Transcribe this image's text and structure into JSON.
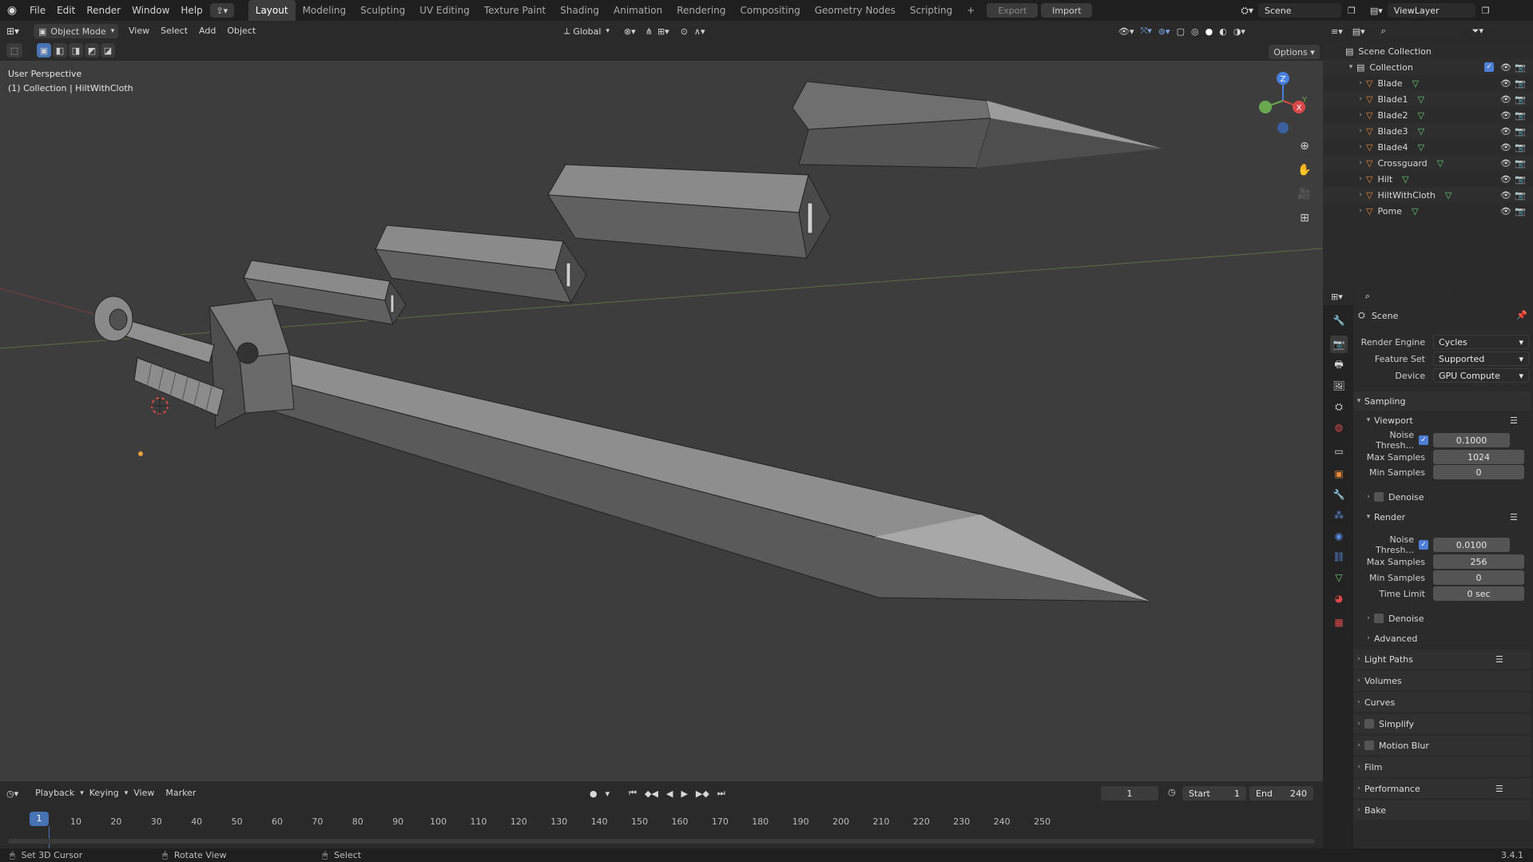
{
  "topbar": {
    "menus": [
      "File",
      "Edit",
      "Render",
      "Window",
      "Help"
    ],
    "workspaces": [
      "Layout",
      "Modeling",
      "Sculpting",
      "UV Editing",
      "Texture Paint",
      "Shading",
      "Animation",
      "Rendering",
      "Compositing",
      "Geometry Nodes",
      "Scripting"
    ],
    "add_tab": "+",
    "export_label": "Export",
    "import_label": "Import",
    "scene_name": "Scene",
    "view_layer": "ViewLayer"
  },
  "viewport_header": {
    "mode": "Object Mode",
    "menus": [
      "View",
      "Select",
      "Add",
      "Object"
    ],
    "transform_orientation": "Global",
    "options_label": "Options"
  },
  "viewport": {
    "perspective_label": "User Perspective",
    "collection_label": "(1) Collection | HiltWithCloth",
    "gizmo_axes": [
      "Z",
      "Y",
      "X"
    ]
  },
  "outliner": {
    "root": "Scene Collection",
    "collection": "Collection",
    "objects": [
      "Blade",
      "Blade1",
      "Blade2",
      "Blade3",
      "Blade4",
      "Crossguard",
      "Hilt",
      "HiltWithCloth",
      "Pome"
    ]
  },
  "properties": {
    "context_title": "Scene",
    "render_engine_label": "Render Engine",
    "render_engine": "Cycles",
    "feature_set_label": "Feature Set",
    "feature_set": "Supported",
    "device_label": "Device",
    "device": "GPU Compute",
    "sampling": "Sampling",
    "viewport_sub": "Viewport",
    "noise_thresh_label": "Noise Thresh...",
    "vp_noise": "0.1000",
    "max_samples_label": "Max Samples",
    "vp_max": "1024",
    "min_samples_label": "Min Samples",
    "vp_min": "0",
    "denoise": "Denoise",
    "render_sub": "Render",
    "r_noise": "0.0100",
    "r_max": "256",
    "r_min": "0",
    "time_limit_label": "Time Limit",
    "r_time": "0 sec",
    "advanced": "Advanced",
    "sections": [
      "Light Paths",
      "Volumes",
      "Curves",
      "Simplify",
      "Motion Blur",
      "Film",
      "Performance",
      "Bake"
    ]
  },
  "timeline": {
    "menus": [
      "Playback",
      "Keying",
      "View",
      "Marker"
    ],
    "current_frame": "1",
    "start_label": "Start",
    "start": "1",
    "end_label": "End",
    "end": "240",
    "ticks": [
      "1",
      "10",
      "20",
      "30",
      "40",
      "50",
      "60",
      "70",
      "80",
      "90",
      "100",
      "110",
      "120",
      "130",
      "140",
      "150",
      "160",
      "170",
      "180",
      "190",
      "200",
      "210",
      "220",
      "230",
      "240",
      "250"
    ]
  },
  "statusbar": {
    "hint1": "Set 3D Cursor",
    "hint2": "Rotate View",
    "hint3": "Select",
    "version": "3.4.1"
  },
  "colors": {
    "accent": "#4772b3",
    "viewport_bg": "#3d3d3d",
    "object_orange": "#e8883a",
    "mesh_green": "#6bcf7f"
  }
}
